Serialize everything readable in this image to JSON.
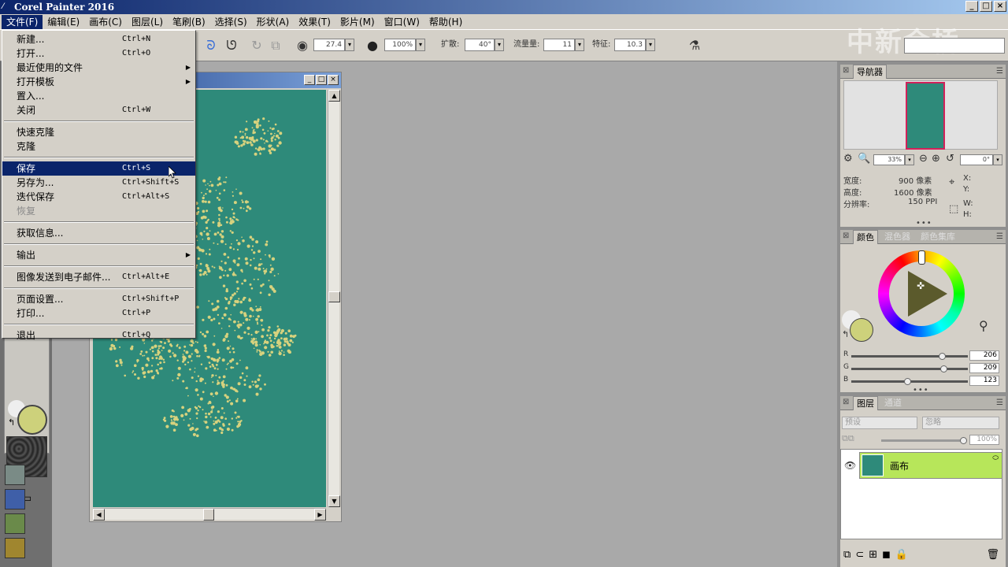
{
  "app": {
    "title": "Corel Painter 2016",
    "icon": "painter-brush-icon",
    "window_buttons": [
      "_",
      "□",
      "×"
    ]
  },
  "menubar": [
    {
      "label": "文件(F)",
      "active": true
    },
    {
      "label": "编辑(E)"
    },
    {
      "label": "画布(C)"
    },
    {
      "label": "图层(L)"
    },
    {
      "label": "笔刷(B)"
    },
    {
      "label": "选择(S)"
    },
    {
      "label": "形状(A)"
    },
    {
      "label": "效果(T)"
    },
    {
      "label": "影片(M)"
    },
    {
      "label": "窗口(W)"
    },
    {
      "label": "帮助(H)"
    }
  ],
  "watermark": "中新金桥",
  "toolbar": {
    "size_value": "27.4",
    "opacity_value": "100%",
    "spread_label": "扩散:",
    "spread_value": "40°",
    "flow_label": "流量量:",
    "flow_value": "11",
    "feature_label": "特征:",
    "feature_value": "10.3"
  },
  "file_menu": {
    "items": [
      {
        "label": "新建...",
        "shortcut": "Ctrl+N"
      },
      {
        "label": "打开...",
        "shortcut": "Ctrl+O"
      },
      {
        "label": "最近使用的文件",
        "submenu": true
      },
      {
        "label": "打开模板",
        "submenu": true
      },
      {
        "label": "置入..."
      },
      {
        "label": "关闭",
        "shortcut": "Ctrl+W"
      },
      {
        "separator": true
      },
      {
        "label": "快速克隆"
      },
      {
        "label": "克隆"
      },
      {
        "separator": true
      },
      {
        "label": "保存",
        "shortcut": "Ctrl+S",
        "highlighted": true
      },
      {
        "label": "另存为...",
        "shortcut": "Ctrl+Shift+S"
      },
      {
        "label": "迭代保存",
        "shortcut": "Ctrl+Alt+S"
      },
      {
        "label": "恢复",
        "disabled": true
      },
      {
        "separator": true
      },
      {
        "label": "获取信息..."
      },
      {
        "separator": true
      },
      {
        "label": "输出",
        "submenu": true
      },
      {
        "separator": true
      },
      {
        "label": "图像发送到电子邮件...",
        "shortcut": "Ctrl+Alt+E"
      },
      {
        "separator": true
      },
      {
        "label": "页面设置...",
        "shortcut": "Ctrl+Shift+P"
      },
      {
        "label": "打印...",
        "shortcut": "Ctrl+P"
      },
      {
        "separator": true
      },
      {
        "label": "退出",
        "shortcut": "Ctrl+Q"
      }
    ]
  },
  "navigator": {
    "tab": "导航器",
    "zoom": "33%",
    "rotation": "0°",
    "width_label": "宽度:",
    "width_value": "900 像素",
    "height_label": "高度:",
    "height_value": "1600 像素",
    "res_label": "分辨率:",
    "res_value": "150 PPI",
    "x_label": "X:",
    "y_label": "Y:",
    "w_label": "W:",
    "h_label": "H:"
  },
  "color_panel": {
    "tabs": [
      "颜色",
      "混色器",
      "颜色集库"
    ],
    "main_color": "#cdd17b",
    "r_label": "R",
    "g_label": "G",
    "b_label": "B",
    "r": "206",
    "g": "209",
    "b": "123"
  },
  "layers_panel": {
    "tabs": [
      "图层",
      "通道"
    ],
    "composite_method": "预设",
    "composite_depth": "忽略",
    "opacity": "100%",
    "layer_name": "画布"
  },
  "colors": {
    "canvas": "#2e8a7a",
    "menu_highlight": "#0a246a",
    "layer_selected": "#b7e65a"
  }
}
